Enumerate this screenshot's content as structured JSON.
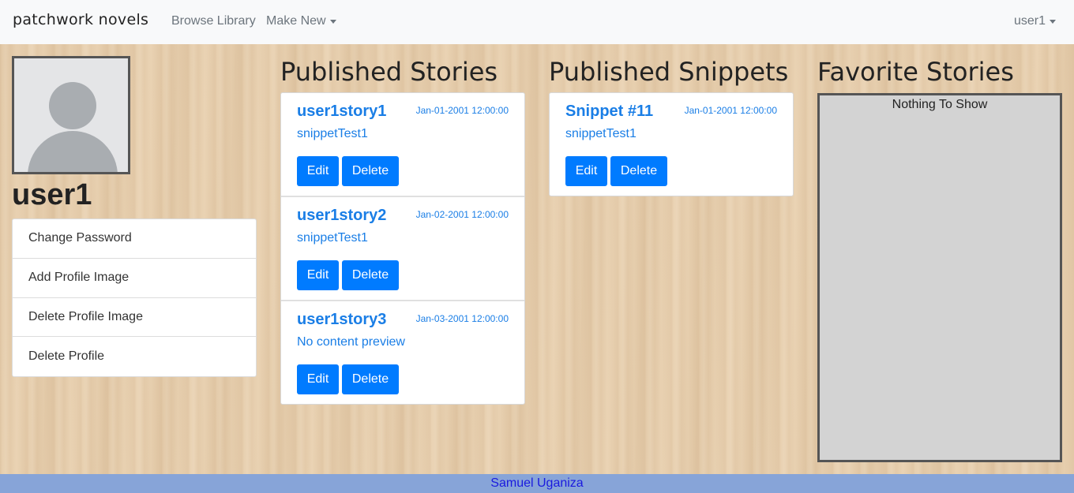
{
  "navbar": {
    "brand": "patchwork novels",
    "browse_label": "Browse Library",
    "make_new_label": "Make New",
    "user_menu_label": "user1"
  },
  "profile": {
    "username": "user1",
    "actions": [
      {
        "label": "Change Password"
      },
      {
        "label": "Add Profile Image"
      },
      {
        "label": "Delete Profile Image"
      },
      {
        "label": "Delete Profile"
      }
    ]
  },
  "stories": {
    "title": "Published Stories",
    "items": [
      {
        "title": "user1story1",
        "date": "Jan-01-2001 12:00:00",
        "preview": "snippetTest1",
        "edit": "Edit",
        "delete": "Delete"
      },
      {
        "title": "user1story2",
        "date": "Jan-02-2001 12:00:00",
        "preview": "snippetTest1",
        "edit": "Edit",
        "delete": "Delete"
      },
      {
        "title": "user1story3",
        "date": "Jan-03-2001 12:00:00",
        "preview": "No content preview",
        "edit": "Edit",
        "delete": "Delete"
      }
    ]
  },
  "snippets": {
    "title": "Published Snippets",
    "items": [
      {
        "title": "Snippet #11",
        "date": "Jan-01-2001 12:00:00",
        "preview": "snippetTest1",
        "edit": "Edit",
        "delete": "Delete"
      }
    ]
  },
  "favorites": {
    "title": "Favorite Stories",
    "empty_text": "Nothing To Show"
  },
  "footer": {
    "text": "Samuel Uganiza"
  },
  "colors": {
    "accent": "#007bff",
    "link": "#1a7ee6",
    "footer_bg": "#87a4d8",
    "navbar_bg": "#f8f9fa"
  }
}
